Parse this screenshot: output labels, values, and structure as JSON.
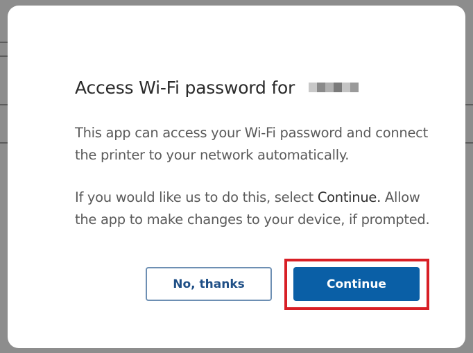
{
  "dialog": {
    "title": "Access Wi-Fi password for",
    "paragraph1": "This app can access your Wi-Fi password and connect the printer to your network automatically.",
    "paragraph2_before": "If you would like us to do this, select ",
    "paragraph2_strong": "Continue.",
    "paragraph2_after": " Allow the app to make changes to your device, if prompted.",
    "secondary_button_label": "No, thanks",
    "primary_button_label": "Continue"
  },
  "colors": {
    "primary": "#0a5fa6",
    "secondary_border": "#6d8fb3",
    "highlight": "#d81f26"
  }
}
